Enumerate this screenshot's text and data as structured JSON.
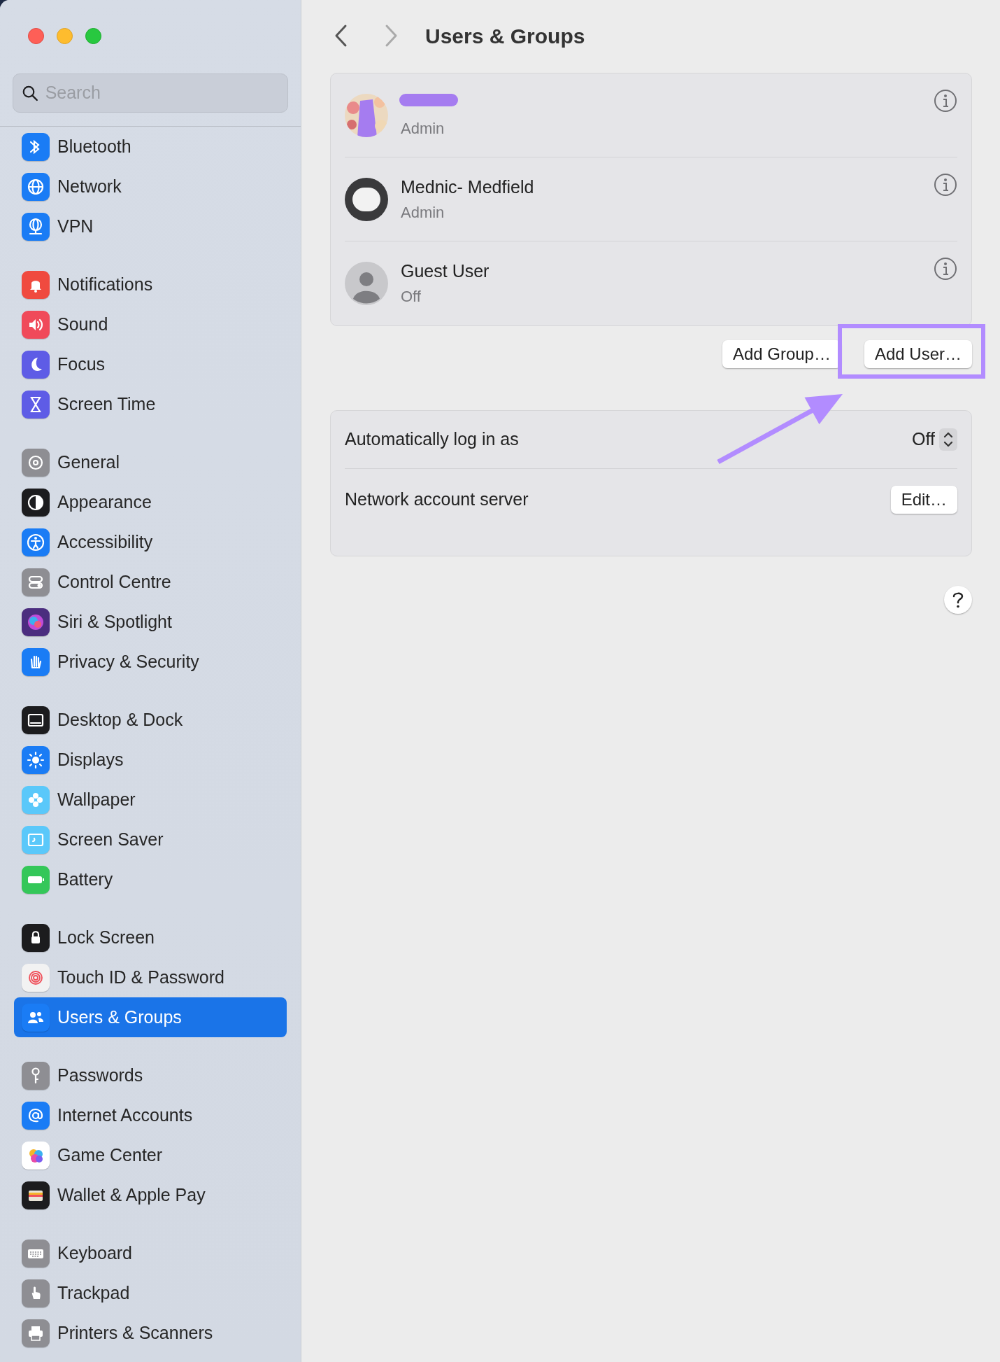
{
  "window": {
    "title": "Users & Groups"
  },
  "search": {
    "placeholder": "Search"
  },
  "sidebar": {
    "groups": [
      {
        "items": [
          {
            "label": "Bluetooth",
            "color": "#1a7cf5",
            "selected": false
          },
          {
            "label": "Network",
            "color": "#1a7cf5",
            "selected": false
          },
          {
            "label": "VPN",
            "color": "#1a7cf5",
            "selected": false
          }
        ]
      },
      {
        "items": [
          {
            "label": "Notifications",
            "color": "#f04a3f",
            "selected": false
          },
          {
            "label": "Sound",
            "color": "#f04a5a",
            "selected": false
          },
          {
            "label": "Focus",
            "color": "#5e5ce6",
            "selected": false
          },
          {
            "label": "Screen Time",
            "color": "#5e5ce6",
            "selected": false
          }
        ]
      },
      {
        "items": [
          {
            "label": "General",
            "color": "#8e8e93",
            "selected": false
          },
          {
            "label": "Appearance",
            "color": "#1c1c1e",
            "selected": false
          },
          {
            "label": "Accessibility",
            "color": "#1a7cf5",
            "selected": false
          },
          {
            "label": "Control Centre",
            "color": "#8e8e93",
            "selected": false
          },
          {
            "label": "Siri & Spotlight",
            "color": "#4b2d7f",
            "selected": false
          },
          {
            "label": "Privacy & Security",
            "color": "#1a7cf5",
            "selected": false
          }
        ]
      },
      {
        "items": [
          {
            "label": "Desktop & Dock",
            "color": "#1c1c1e",
            "selected": false
          },
          {
            "label": "Displays",
            "color": "#1a7cf5",
            "selected": false
          },
          {
            "label": "Wallpaper",
            "color": "#5ac8fa",
            "selected": false
          },
          {
            "label": "Screen Saver",
            "color": "#5ac8fa",
            "selected": false
          },
          {
            "label": "Battery",
            "color": "#34c759",
            "selected": false
          }
        ]
      },
      {
        "items": [
          {
            "label": "Lock Screen",
            "color": "#1c1c1e",
            "selected": false
          },
          {
            "label": "Touch ID & Password",
            "color": "#f2f2f2",
            "selected": false
          },
          {
            "label": "Users & Groups",
            "color": "#1a7cf5",
            "selected": true
          }
        ]
      },
      {
        "items": [
          {
            "label": "Passwords",
            "color": "#8e8e93",
            "selected": false
          },
          {
            "label": "Internet Accounts",
            "color": "#1a7cf5",
            "selected": false
          },
          {
            "label": "Game Center",
            "color": "#ffffff",
            "selected": false
          },
          {
            "label": "Wallet & Apple Pay",
            "color": "#1c1c1e",
            "selected": false
          }
        ]
      },
      {
        "items": [
          {
            "label": "Keyboard",
            "color": "#8e8e93",
            "selected": false
          },
          {
            "label": "Trackpad",
            "color": "#8e8e93",
            "selected": false
          },
          {
            "label": "Printers & Scanners",
            "color": "#8e8e93",
            "selected": false
          }
        ]
      }
    ]
  },
  "users": [
    {
      "role": "Admin",
      "kind": "picture",
      "redacted": true
    },
    {
      "name": "Mednic- Medfield",
      "role": "Admin",
      "kind": "memoji",
      "redacted": false
    },
    {
      "name": "Guest User",
      "role": "Off",
      "kind": "silhouette",
      "redacted": false
    }
  ],
  "user_buttons": [
    "Add Group…",
    "Add User…"
  ],
  "settings": [
    {
      "kind": "popup",
      "label": "Automatically log in as",
      "value": "Off"
    },
    {
      "kind": "button",
      "label": "Network account server",
      "button": "Edit…"
    }
  ]
}
